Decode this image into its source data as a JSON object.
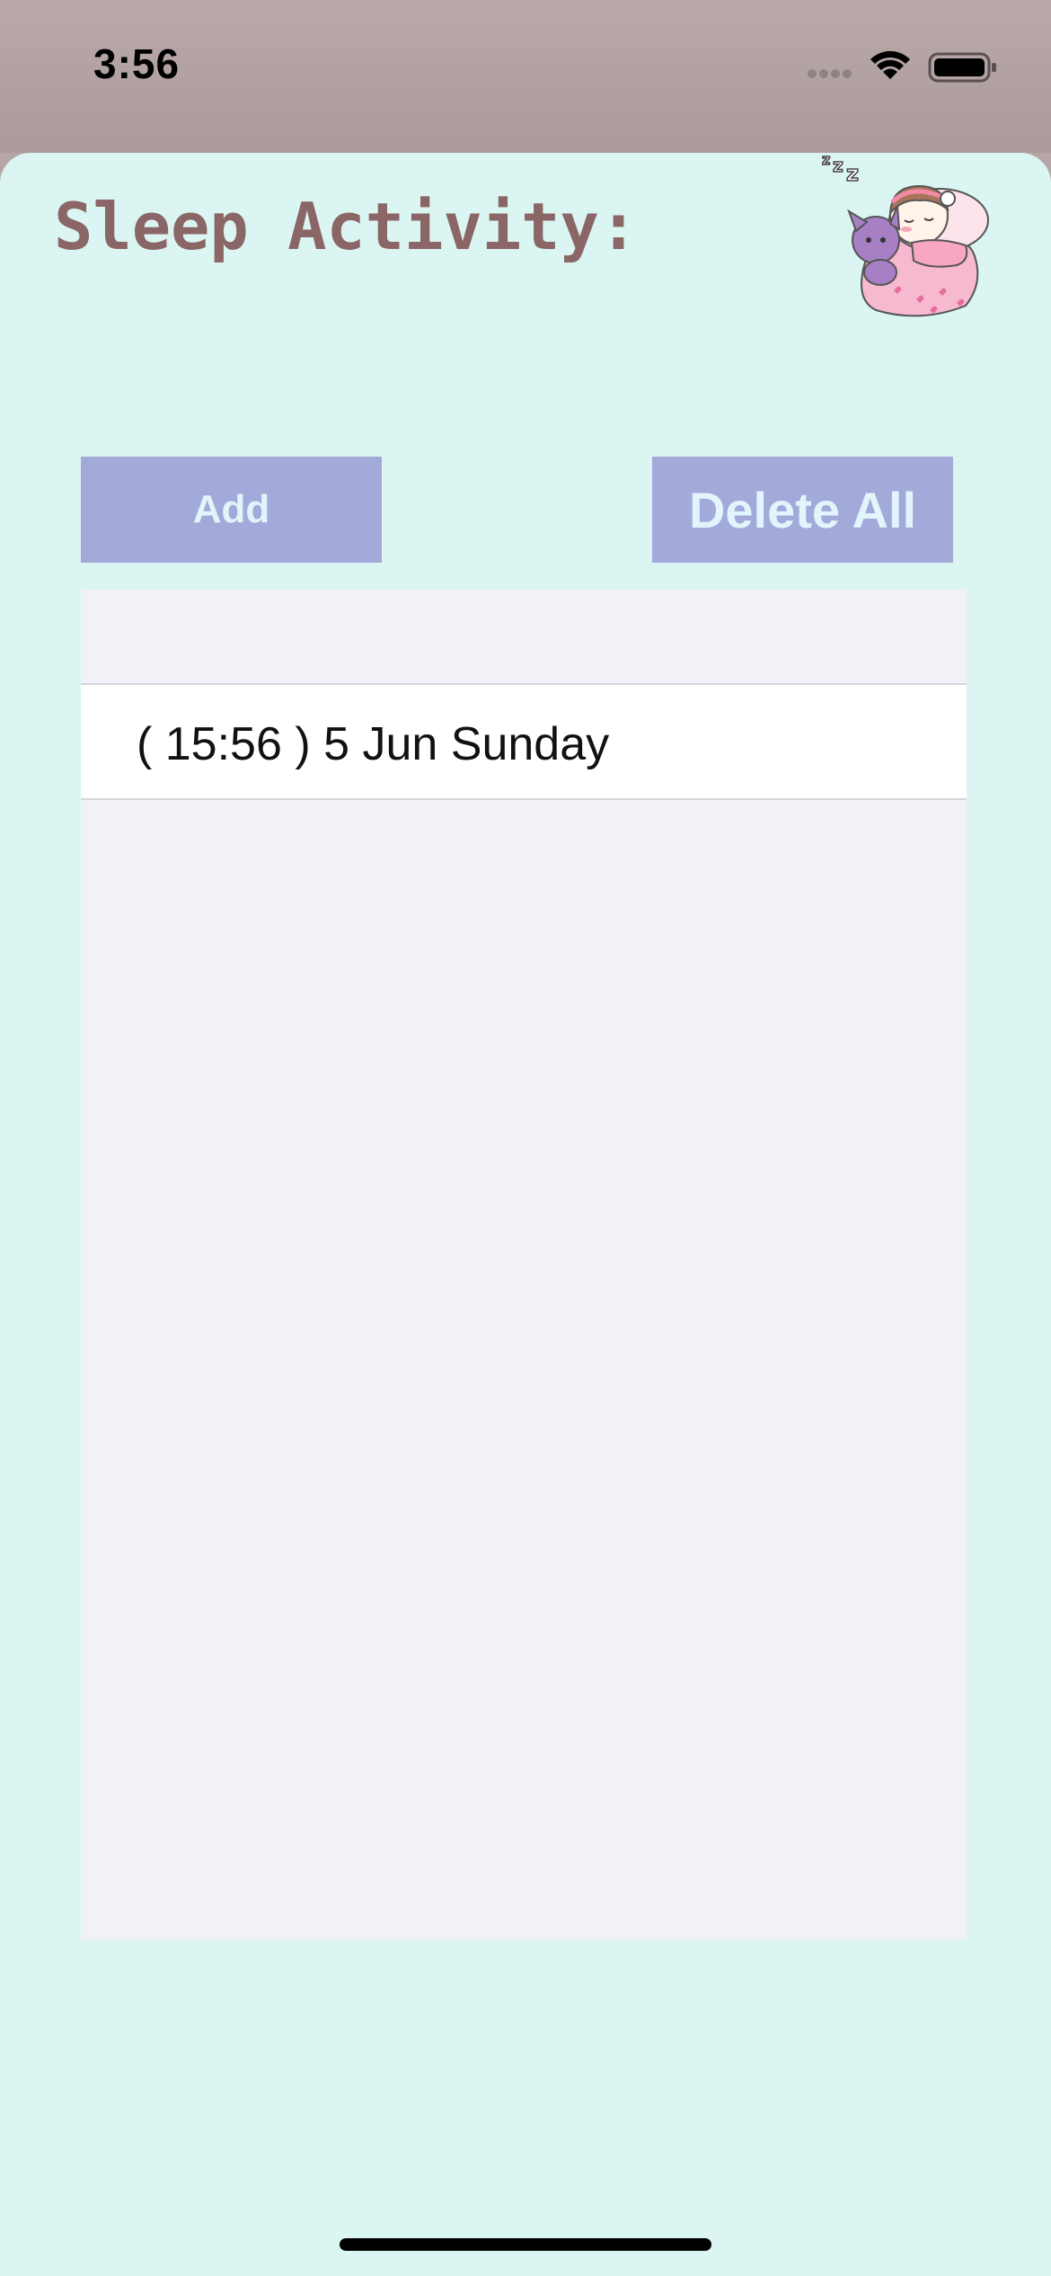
{
  "status_bar": {
    "time": "3:56",
    "icons": [
      "cellular-signal-icon",
      "wifi-icon",
      "battery-icon"
    ]
  },
  "page": {
    "title": "Sleep Activity:",
    "illustration": "sleeping-girl-illustration",
    "accent_color": "#a3a9d9",
    "background_color": "#dbf6f2",
    "title_color": "#8b6667"
  },
  "buttons": {
    "add_label": "Add",
    "delete_all_label": "Delete All"
  },
  "activities": [
    {
      "label": "( 15:56 ) 5 Jun Sunday"
    }
  ]
}
